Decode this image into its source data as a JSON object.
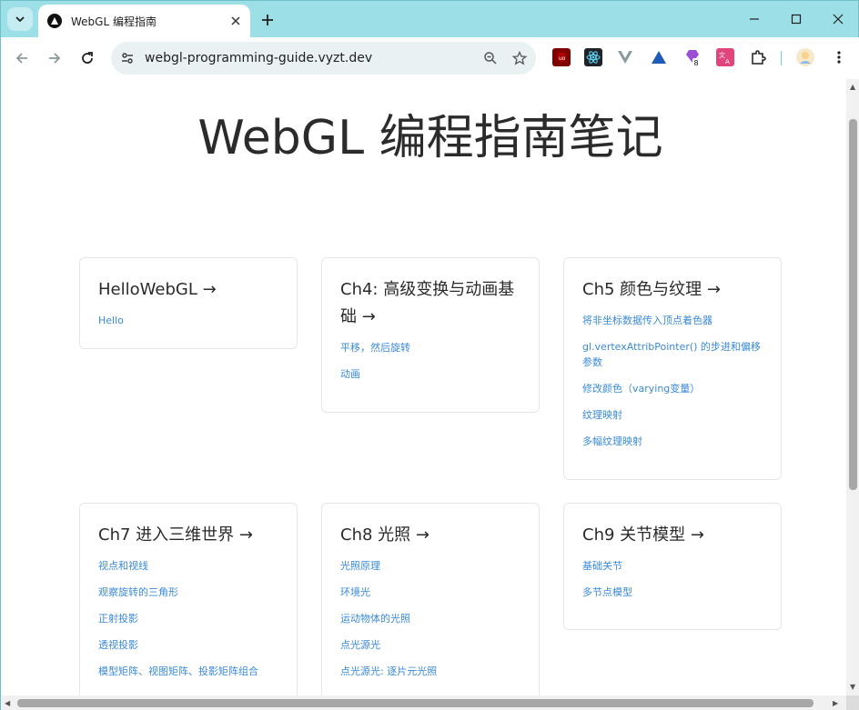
{
  "browser": {
    "tab_title": "WebGL 编程指南",
    "url": "webgl-programming-guide.vyzt.dev",
    "extension_badge": "8",
    "icons": [
      "search-tabs-icon",
      "close-icon",
      "plus-icon",
      "minimize-icon",
      "maximize-icon",
      "close-window-icon",
      "back-icon",
      "forward-icon",
      "reload-icon",
      "site-info-icon",
      "zoom-icon",
      "star-icon",
      "ublock-icon",
      "react-icon",
      "vue-icon",
      "triangle-extension-icon",
      "gem-extension-icon",
      "translate-extension-icon",
      "puzzle-icon",
      "avatar",
      "menu-icon"
    ]
  },
  "page": {
    "title": "WebGL 编程指南笔记",
    "cards": [
      {
        "title": "HelloWebGL →",
        "links": [
          "Hello"
        ]
      },
      {
        "title": "Ch4: 高级变换与动画基础 →",
        "links": [
          "平移，然后旋转",
          "动画"
        ]
      },
      {
        "title": "Ch5 颜色与纹理 →",
        "links": [
          "将非坐标数据传入顶点着色器",
          "gl.vertexAttribPointer() 的步进和偏移参数",
          "修改颜色（varying变量）",
          "纹理映射",
          "多幅纹理映射"
        ]
      },
      {
        "title": "Ch7 进入三维世界 →",
        "links": [
          "视点和视线",
          "观察旋转的三角形",
          "正射投影",
          "透视投影",
          "模型矩阵、视图矩阵、投影矩阵组合"
        ]
      },
      {
        "title": "Ch8 光照 →",
        "links": [
          "光照原理",
          "环境光",
          "运动物体的光照",
          "点光源光",
          "点光源光: 逐片元光照"
        ]
      },
      {
        "title": "Ch9 关节模型 →",
        "links": [
          "基础关节",
          "多节点模型"
        ]
      }
    ]
  },
  "colors": {
    "frame": "#9ddfe6",
    "link": "#3a8ad8",
    "title": "#2b2b2b"
  }
}
